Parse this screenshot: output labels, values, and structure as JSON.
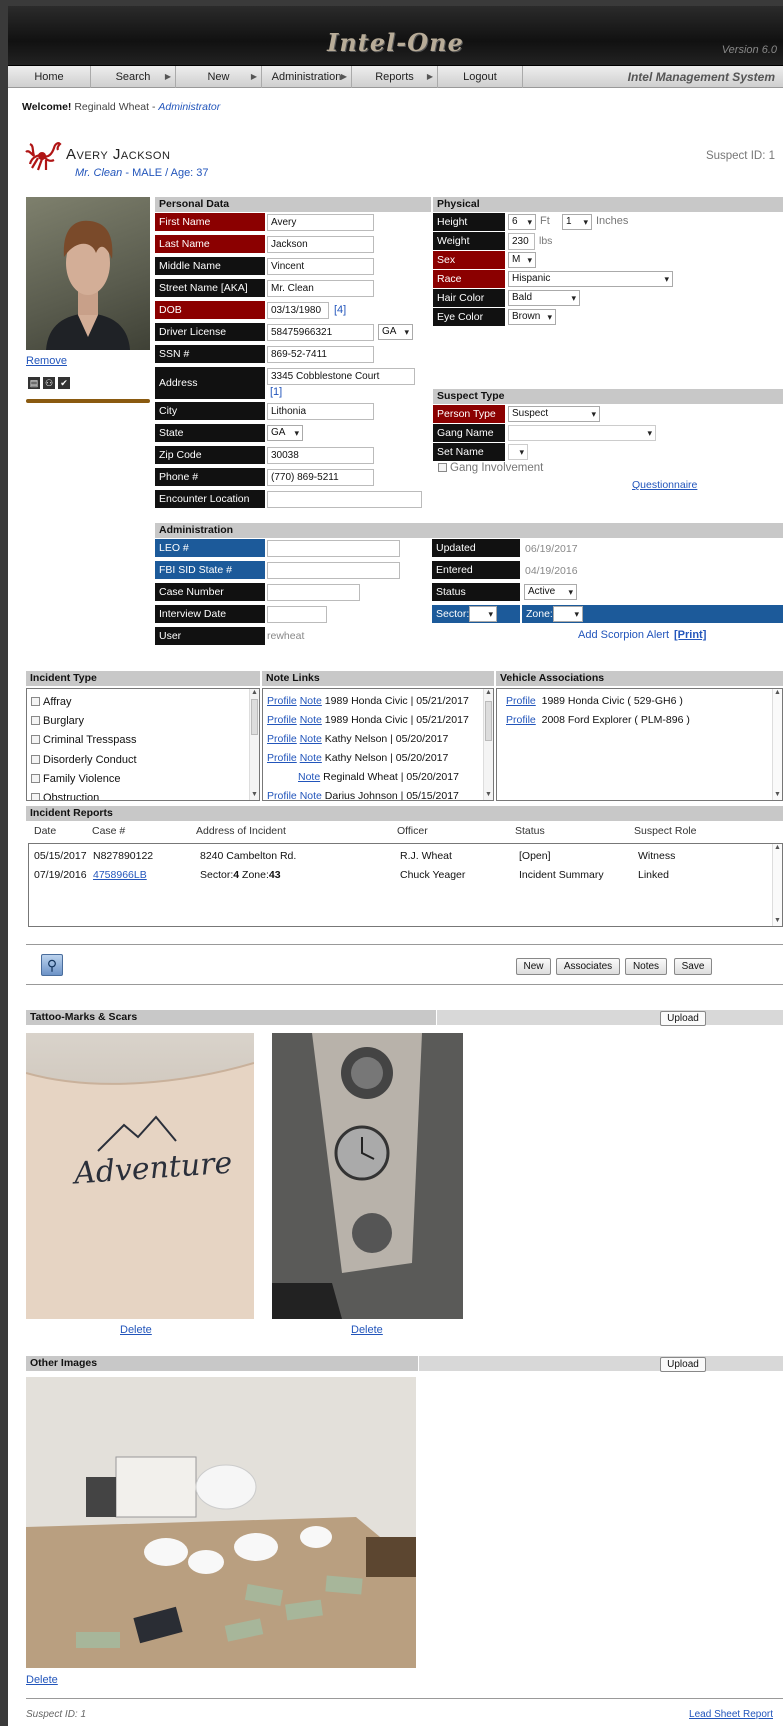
{
  "app": {
    "logo": "Intel-One",
    "version": "Version 6.0",
    "system_name": "Intel Management System"
  },
  "nav": {
    "items": [
      {
        "label": "Home"
      },
      {
        "label": "Search"
      },
      {
        "label": "New"
      },
      {
        "label": "Administration"
      },
      {
        "label": "Reports"
      },
      {
        "label": "Logout"
      }
    ]
  },
  "welcome": {
    "prefix": "Welcome!",
    "user": "Reginald Wheat",
    "sep": "-",
    "role": "Administrator"
  },
  "suspect": {
    "name": "Avery Jackson",
    "alias": "Mr. Clean",
    "gender": "MALE",
    "age_text": "/ Age: 37",
    "alias_sep": "-",
    "id_label": "Suspect ID: 1"
  },
  "photo_actions": {
    "remove": "Remove"
  },
  "personal": {
    "title": "Personal Data",
    "first_name_label": "First Name",
    "first_name": "Avery",
    "last_name_label": "Last Name",
    "last_name": "Jackson",
    "middle_name_label": "Middle Name",
    "middle_name": "Vincent",
    "street_name_label": "Street Name [AKA]",
    "street_name": "Mr. Clean",
    "dob_label": "DOB",
    "dob": "03/13/1980",
    "dob_link": "[4]",
    "dl_label": "Driver License",
    "dl": "58475966321",
    "dl_state": "GA",
    "ssn_label": "SSN #",
    "ssn": "869-52-7411",
    "address_label": "Address",
    "address": "3345 Cobblestone Court",
    "address_link": "[1]",
    "city_label": "City",
    "city": "Lithonia",
    "state_label": "State",
    "state": "GA",
    "zip_label": "Zip Code",
    "zip": "30038",
    "phone_label": "Phone #",
    "phone": "(770) 869-5211",
    "encounter_label": "Encounter Location",
    "encounter": ""
  },
  "physical": {
    "title": "Physical",
    "height_label": "Height",
    "height_ft": "6",
    "ft_unit": "Ft",
    "height_in": "1",
    "in_unit": "Inches",
    "weight_label": "Weight",
    "weight": "230",
    "weight_unit": "lbs",
    "sex_label": "Sex",
    "sex": "M",
    "race_label": "Race",
    "race": "Hispanic",
    "hair_label": "Hair Color",
    "hair": "Bald",
    "eye_label": "Eye Color",
    "eye": "Brown"
  },
  "suspect_type": {
    "title": "Suspect Type",
    "person_type_label": "Person Type",
    "person_type": "Suspect",
    "gang_name_label": "Gang Name",
    "gang_name": "",
    "set_name_label": "Set Name",
    "set_name": "",
    "gang_involvement": "Gang Involvement",
    "questionnaire": "Questionnaire"
  },
  "admin": {
    "title": "Administration",
    "leo_label": "LEO #",
    "leo": "",
    "fbi_label": "FBI SID State #",
    "fbi": "",
    "case_label": "Case Number",
    "case": "",
    "interview_label": "Interview Date",
    "interview": "",
    "user_label": "User",
    "user": "rewheat",
    "updated_label": "Updated",
    "updated": "06/19/2017",
    "entered_label": "Entered",
    "entered": "04/19/2016",
    "status_label": "Status",
    "status": "Active",
    "sector_label": "Sector:",
    "zone_label": "Zone:",
    "scorpion_alert": "Add Scorpion Alert",
    "print": "[Print]"
  },
  "incident_type": {
    "title": "Incident Type",
    "items": [
      "Affray",
      "Burglary",
      "Criminal Tresspass",
      "Disorderly Conduct",
      "Family Violence",
      "Obstruction"
    ]
  },
  "note_links": {
    "title": "Note Links",
    "rows": [
      {
        "profile": "Profile",
        "note": "Note",
        "text": "1989 Honda Civic | 05/21/2017"
      },
      {
        "profile": "Profile",
        "note": "Note",
        "text": "1989 Honda Civic | 05/21/2017"
      },
      {
        "profile": "Profile",
        "note": "Note",
        "text": "Kathy Nelson | 05/20/2017"
      },
      {
        "profile": "Profile",
        "note": "Note",
        "text": "Kathy Nelson | 05/20/2017"
      },
      {
        "profile": "",
        "note": "Note",
        "text": "Reginald Wheat | 05/20/2017"
      },
      {
        "profile": "Profile",
        "note": "Note",
        "text": "Darius Johnson | 05/15/2017"
      }
    ]
  },
  "vehicles": {
    "title": "Vehicle Associations",
    "rows": [
      {
        "profile": "Profile",
        "text": "1989 Honda Civic ( 529-GH6 )"
      },
      {
        "profile": "Profile",
        "text": "2008 Ford Explorer ( PLM-896 )"
      }
    ]
  },
  "incident_reports": {
    "title": "Incident Reports",
    "columns": [
      "Date",
      "Case #",
      "Address of Incident",
      "Officer",
      "Status",
      "Suspect Role"
    ],
    "rows": [
      {
        "date": "05/15/2017",
        "case": "N827890122",
        "address": "8240 Cambelton Rd.",
        "officer": "R.J. Wheat",
        "status": "[Open]",
        "role": "Witness"
      },
      {
        "date": "07/19/2016",
        "case": "4758966LB",
        "sector_label": "Sector:",
        "sector": "4",
        "zone_label": "Zone:",
        "zone": "43",
        "officer": "Chuck Yeager",
        "status": "Incident Summary",
        "role": "Linked"
      }
    ]
  },
  "actions": {
    "new": "New",
    "associates": "Associates",
    "notes": "Notes",
    "save": "Save"
  },
  "tattoos": {
    "title": "Tattoo-Marks & Scars",
    "upload": "Upload",
    "delete": "Delete",
    "tattoo1_text": "Adventure"
  },
  "other_images": {
    "title": "Other Images",
    "upload": "Upload",
    "delete": "Delete"
  },
  "footer": {
    "suspect_id": "Suspect ID: 1",
    "lead_sheet": "Lead Sheet Report"
  },
  "colors": {
    "label_black": "#111111",
    "label_red": "#8b0000",
    "label_blue": "#1c5a9a",
    "link": "#2255bb",
    "section_gray": "#c8c8c8"
  }
}
